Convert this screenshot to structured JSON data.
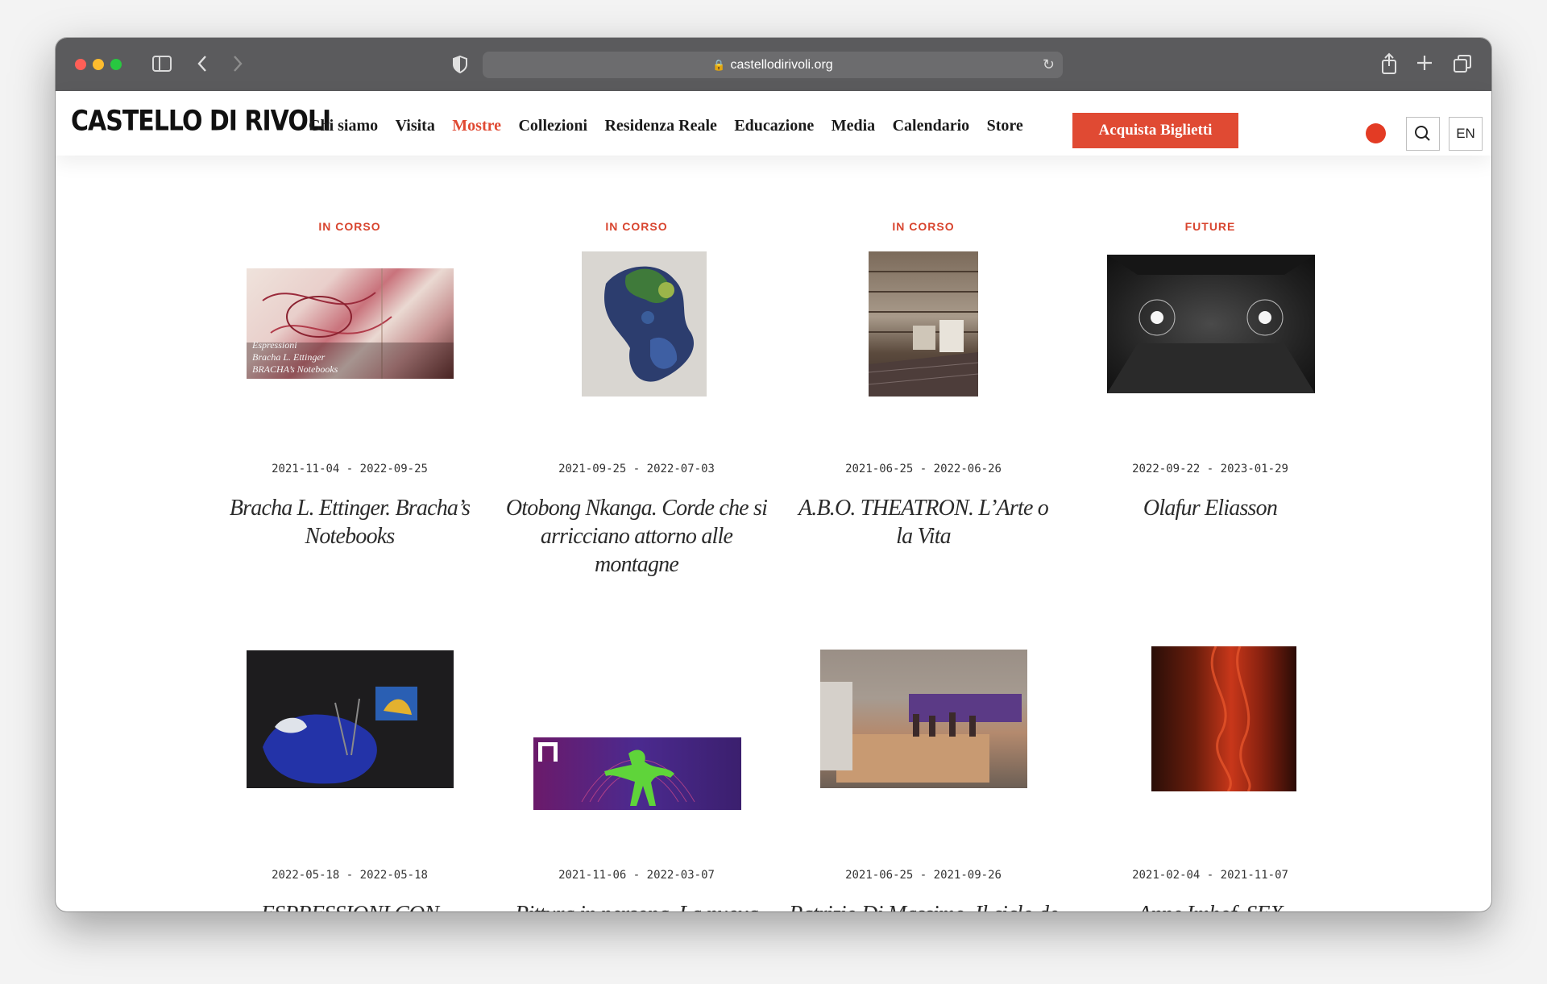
{
  "browser": {
    "url": "castellodirivoli.org"
  },
  "site": {
    "logo": "CASTELLO DI RIVOLI",
    "nav": [
      "Chi siamo",
      "Visita",
      "Mostre",
      "Collezioni",
      "Residenza Reale",
      "Educazione",
      "Media",
      "Calendario",
      "Store"
    ],
    "active_nav": "Mostre",
    "tickets_button": "Acquista Biglietti",
    "language": "EN",
    "accent_color": "#e04a33"
  },
  "exhibitions": [
    {
      "status": "IN CORSO",
      "dates": "2021-11-04 - 2022-09-25",
      "title": "Bracha L. Ettinger. Bracha’s Notebooks",
      "thumb_caption": [
        "Espressioni",
        "Bracha L. Ettinger",
        "BRACHA’s Notebooks"
      ]
    },
    {
      "status": "IN CORSO",
      "dates": "2021-09-25 - 2022-07-03",
      "title": "Otobong Nkanga. Corde che si arricciano attorno alle montagne"
    },
    {
      "status": "IN CORSO",
      "dates": "2021-06-25 - 2022-06-26",
      "title": "A.B.O. THEATRON. L’Arte o la Vita"
    },
    {
      "status": "FUTURE",
      "dates": "2022-09-22 - 2023-01-29",
      "title": "Olafur Eliasson"
    },
    {
      "status": "",
      "dates": "2022-05-18 - 2022-05-18",
      "title": "ESPRESSIONI CON FRAZIONI –"
    },
    {
      "status": "",
      "dates": "2021-11-06 - 2022-03-07",
      "title": "Pittura in persona. La nuova Collezione della"
    },
    {
      "status": "",
      "dates": "2021-06-25 - 2021-09-26",
      "title": "Patrizio Di Massimo. Il ciclo de La Risalita"
    },
    {
      "status": "",
      "dates": "2021-02-04 - 2021-11-07",
      "title": "Anne Imhof. SEX"
    }
  ]
}
